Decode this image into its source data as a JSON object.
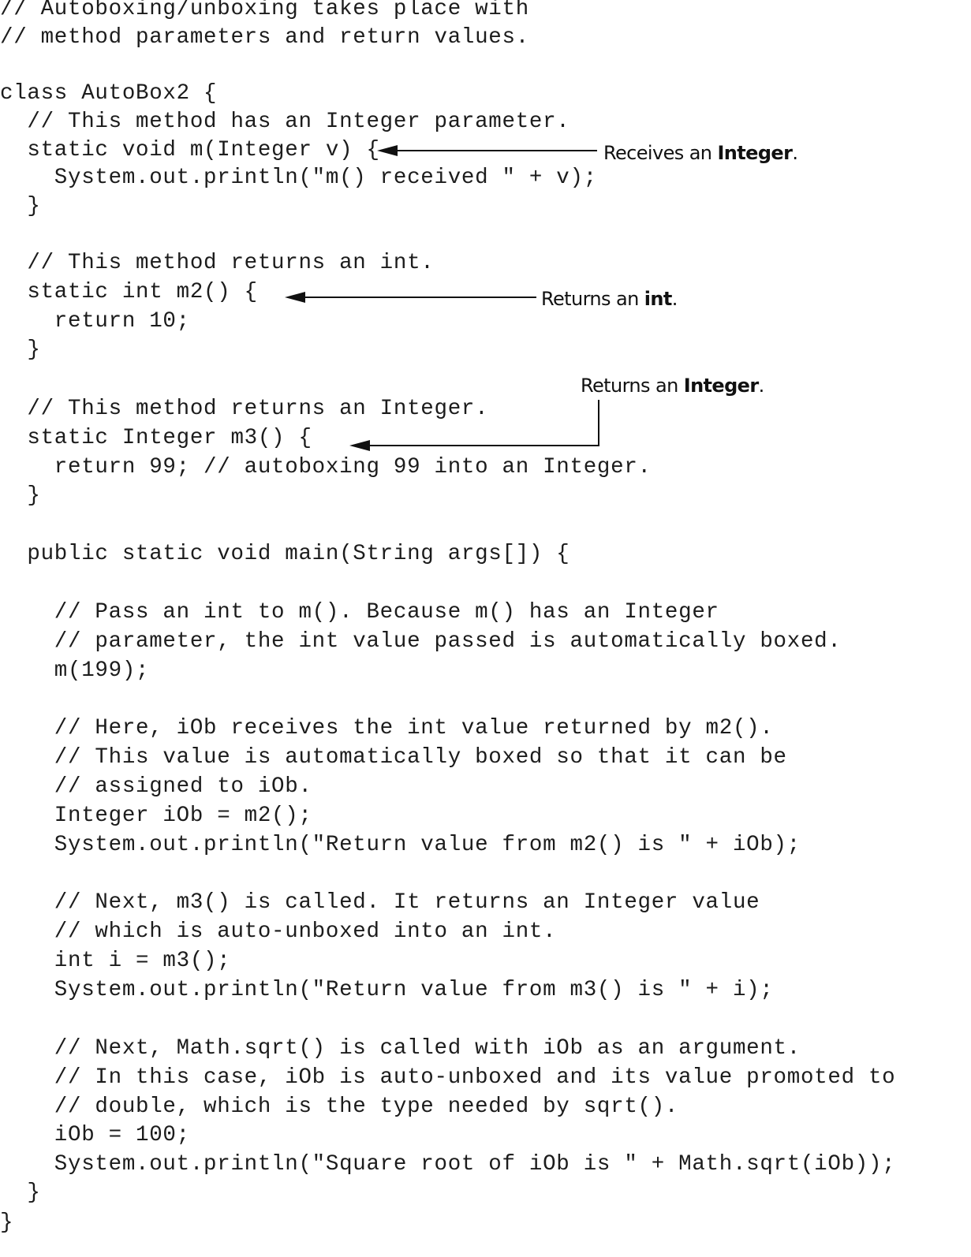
{
  "code_lines": [
    "// Autoboxing/unboxing takes place with",
    "// method parameters and return values.",
    "",
    "class AutoBox2 {",
    "  // This method has an Integer parameter.",
    "  static void m(Integer v) {",
    "    System.out.println(\"m() received \" + v);",
    "  }",
    "",
    "  // This method returns an int.",
    "  static int m2() {",
    "    return 10;",
    "  }",
    "",
    "  // This method returns an Integer.",
    "  static Integer m3() {",
    "    return 99; // autoboxing 99 into an Integer.",
    "  }",
    "",
    "  public static void main(String args[]) {",
    "",
    "    // Pass an int to m(). Because m() has an Integer",
    "    // parameter, the int value passed is automatically boxed.",
    "    m(199);",
    "",
    "    // Here, iOb receives the int value returned by m2().",
    "    // This value is automatically boxed so that it can be",
    "    // assigned to iOb.",
    "    Integer iOb = m2();",
    "    System.out.println(\"Return value from m2() is \" + iOb);",
    "",
    "    // Next, m3() is called. It returns an Integer value",
    "    // which is auto-unboxed into an int.",
    "    int i = m3();",
    "    System.out.println(\"Return value from m3() is \" + i);",
    "",
    "    // Next, Math.sqrt() is called with iOb as an argument.",
    "    // In this case, iOb is auto-unboxed and its value promoted to",
    "    // double, which is the type needed by sqrt().",
    "    iOb = 100;",
    "    System.out.println(\"Square root of iOb is \" + Math.sqrt(iOb));",
    "  }",
    "}"
  ],
  "annotations": {
    "receives_integer": {
      "prefix": "Receives an ",
      "bold": "Integer",
      "suffix": "."
    },
    "returns_int": {
      "prefix": "Returns an ",
      "bold": "int",
      "suffix": "."
    },
    "returns_integer": {
      "prefix": "Returns an ",
      "bold": "Integer",
      "suffix": "."
    }
  },
  "colors": {
    "text": "#1c1c1c",
    "background": "#ffffff",
    "arrow": "#111111"
  }
}
